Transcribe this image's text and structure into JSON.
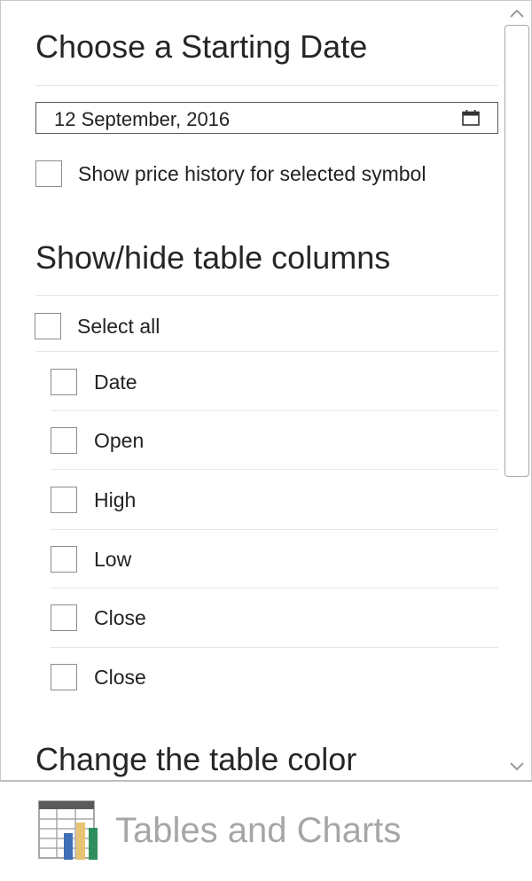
{
  "section_date": {
    "heading": "Choose a Starting Date",
    "date_value": "12 September, 2016",
    "calendar_icon": "calendar-icon",
    "price_history_label": "Show price history for selected symbol"
  },
  "section_columns": {
    "heading": "Show/hide table columns",
    "select_all_label": "Select all",
    "columns": [
      "Date",
      "Open",
      "High",
      "Low",
      "Close",
      "Close"
    ]
  },
  "section_color": {
    "heading": "Change the table color"
  },
  "footer": {
    "title": "Tables and Charts",
    "logo_icon": "table-chart-icon"
  },
  "colors": {
    "bar_blue": "#3f6fb6",
    "bar_yellow": "#e8c472",
    "bar_green": "#2f8f5c",
    "footer_text": "#a6a6a6"
  }
}
